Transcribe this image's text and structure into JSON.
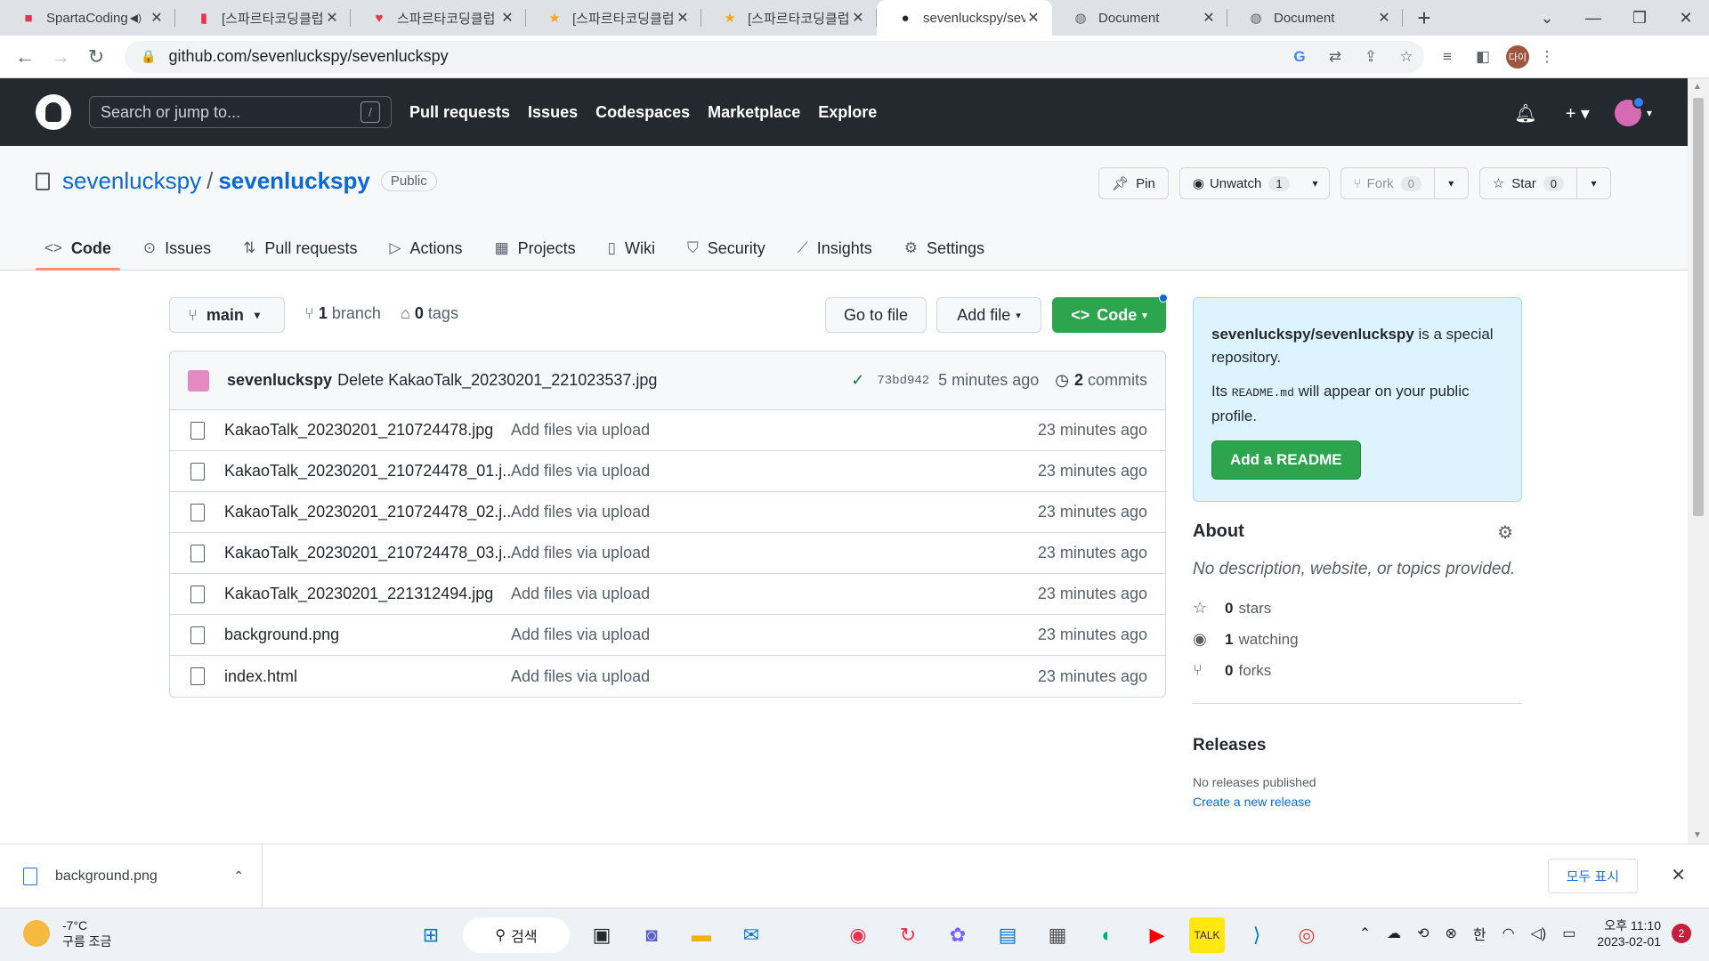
{
  "browser": {
    "tabs": [
      {
        "title": "SpartaCoding",
        "favicon": "sparta-icon",
        "color": "#e8344e",
        "audio": true
      },
      {
        "title": "[스파르타코딩클럽",
        "favicon": "book-icon",
        "color": "#e8344e"
      },
      {
        "title": "스파르타코딩클럽",
        "favicon": "heart-icon",
        "color": "#e8344e"
      },
      {
        "title": "[스파르타코딩클럽",
        "favicon": "star-icon",
        "color": "#f5a623"
      },
      {
        "title": "[스파르타코딩클럽",
        "favicon": "star-icon",
        "color": "#f5a623"
      },
      {
        "title": "sevenluckspy/sev",
        "favicon": "github-icon",
        "color": "#24292f",
        "active": true
      },
      {
        "title": "Document",
        "favicon": "globe-icon",
        "color": "#5f6368"
      },
      {
        "title": "Document",
        "favicon": "globe-icon",
        "color": "#5f6368"
      }
    ],
    "url": "github.com/sevenluckspy/sevenluckspy",
    "profile_initials": "다이"
  },
  "github": {
    "search_placeholder": "Search or jump to...",
    "search_shortcut": "/",
    "nav": [
      "Pull requests",
      "Issues",
      "Codespaces",
      "Marketplace",
      "Explore"
    ]
  },
  "repo": {
    "owner": "sevenluckspy",
    "name": "sevenluckspy",
    "visibility": "Public",
    "pin_label": "Pin",
    "unwatch_label": "Unwatch",
    "watch_count": "1",
    "fork_label": "Fork",
    "fork_count": "0",
    "star_label": "Star",
    "star_count": "0",
    "tabs": [
      {
        "label": "Code",
        "icon": "code-icon",
        "active": true
      },
      {
        "label": "Issues",
        "icon": "issue-icon"
      },
      {
        "label": "Pull requests",
        "icon": "pull-request-icon"
      },
      {
        "label": "Actions",
        "icon": "play-icon"
      },
      {
        "label": "Projects",
        "icon": "table-icon"
      },
      {
        "label": "Wiki",
        "icon": "book-icon"
      },
      {
        "label": "Security",
        "icon": "shield-icon"
      },
      {
        "label": "Insights",
        "icon": "graph-icon"
      },
      {
        "label": "Settings",
        "icon": "gear-icon"
      }
    ]
  },
  "code": {
    "branch": "main",
    "branch_count": "1",
    "branch_word": "branch",
    "tag_count": "0",
    "tag_word": "tags",
    "go_to_file": "Go to file",
    "add_file": "Add file",
    "code_button": "Code",
    "commit": {
      "user": "sevenluckspy",
      "message": "Delete KakaoTalk_20230201_221023537.jpg",
      "hash": "73bd942",
      "time": "5 minutes ago",
      "commit_count": "2",
      "commit_word": "commits"
    },
    "files": [
      {
        "name": "KakaoTalk_20230201_210724478.jpg",
        "message": "Add files via upload",
        "time": "23 minutes ago"
      },
      {
        "name": "KakaoTalk_20230201_210724478_01.j...",
        "message": "Add files via upload",
        "time": "23 minutes ago"
      },
      {
        "name": "KakaoTalk_20230201_210724478_02.j...",
        "message": "Add files via upload",
        "time": "23 minutes ago"
      },
      {
        "name": "KakaoTalk_20230201_210724478_03.j...",
        "message": "Add files via upload",
        "time": "23 minutes ago"
      },
      {
        "name": "KakaoTalk_20230201_221312494.jpg",
        "message": "Add files via upload",
        "time": "23 minutes ago"
      },
      {
        "name": "background.png",
        "message": "Add files via upload",
        "time": "23 minutes ago"
      },
      {
        "name": "index.html",
        "message": "Add files via upload",
        "time": "23 minutes ago"
      }
    ]
  },
  "sidebar": {
    "special_repo": "sevenluckspy/sevenluckspy",
    "special_text": "is a special repository.",
    "readme_pre": "Its",
    "readme_code": "README.md",
    "readme_post": "will appear on your public profile.",
    "add_readme": "Add a README",
    "about_title": "About",
    "about_desc": "No description, website, or topics provided.",
    "stars_count": "0",
    "stars_label": "stars",
    "watching_count": "1",
    "watching_label": "watching",
    "forks_count": "0",
    "forks_label": "forks",
    "releases_title": "Releases",
    "releases_none": "No releases published",
    "create_release": "Create a new release"
  },
  "downloads": {
    "file": "background.png",
    "show_all": "모두 표시"
  },
  "taskbar": {
    "temp": "-7°C",
    "weather": "구름 조금",
    "search": "검색",
    "ime": "한",
    "time": "오후 11:10",
    "date": "2023-02-01",
    "notifications": "2"
  }
}
